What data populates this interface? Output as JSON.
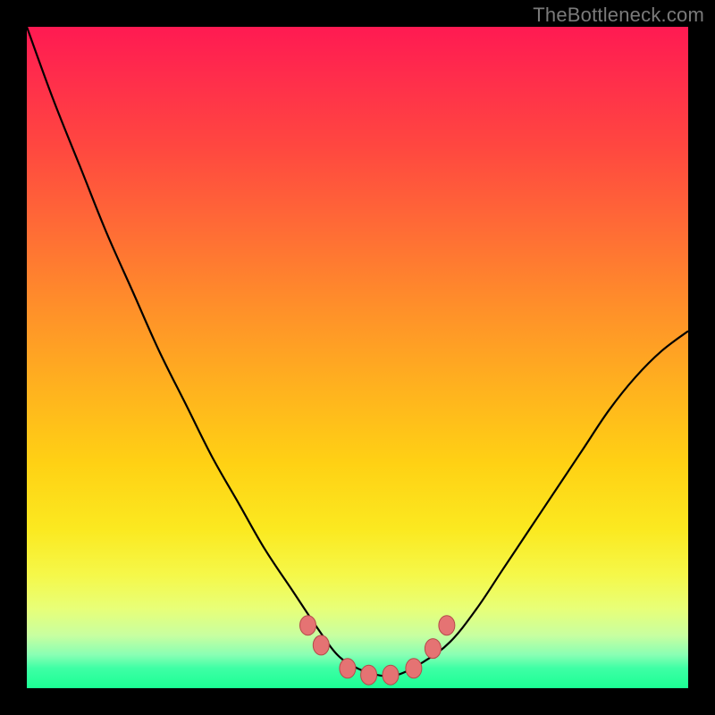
{
  "watermark": "TheBottleneck.com",
  "chart_data": {
    "type": "line",
    "title": "",
    "xlabel": "",
    "ylabel": "",
    "xlim": [
      0,
      1
    ],
    "ylim": [
      0,
      1
    ],
    "grid": false,
    "series": [
      {
        "name": "curve",
        "x": [
          0.0,
          0.04,
          0.08,
          0.12,
          0.16,
          0.2,
          0.24,
          0.28,
          0.32,
          0.36,
          0.4,
          0.44,
          0.47,
          0.5,
          0.53,
          0.56,
          0.6,
          0.64,
          0.68,
          0.72,
          0.76,
          0.8,
          0.84,
          0.88,
          0.92,
          0.96,
          1.0
        ],
        "y": [
          1.0,
          0.89,
          0.79,
          0.69,
          0.6,
          0.51,
          0.43,
          0.35,
          0.28,
          0.21,
          0.15,
          0.09,
          0.05,
          0.03,
          0.02,
          0.02,
          0.04,
          0.07,
          0.12,
          0.18,
          0.24,
          0.3,
          0.36,
          0.42,
          0.47,
          0.51,
          0.54
        ]
      }
    ],
    "markers": [
      {
        "x": 0.425,
        "y": 0.095
      },
      {
        "x": 0.445,
        "y": 0.065
      },
      {
        "x": 0.485,
        "y": 0.03
      },
      {
        "x": 0.517,
        "y": 0.02
      },
      {
        "x": 0.55,
        "y": 0.02
      },
      {
        "x": 0.585,
        "y": 0.03
      },
      {
        "x": 0.614,
        "y": 0.06
      },
      {
        "x": 0.635,
        "y": 0.095
      }
    ],
    "colors": {
      "curve": "#000000",
      "marker_fill": "#e57373",
      "marker_stroke": "#b44a4a"
    }
  }
}
